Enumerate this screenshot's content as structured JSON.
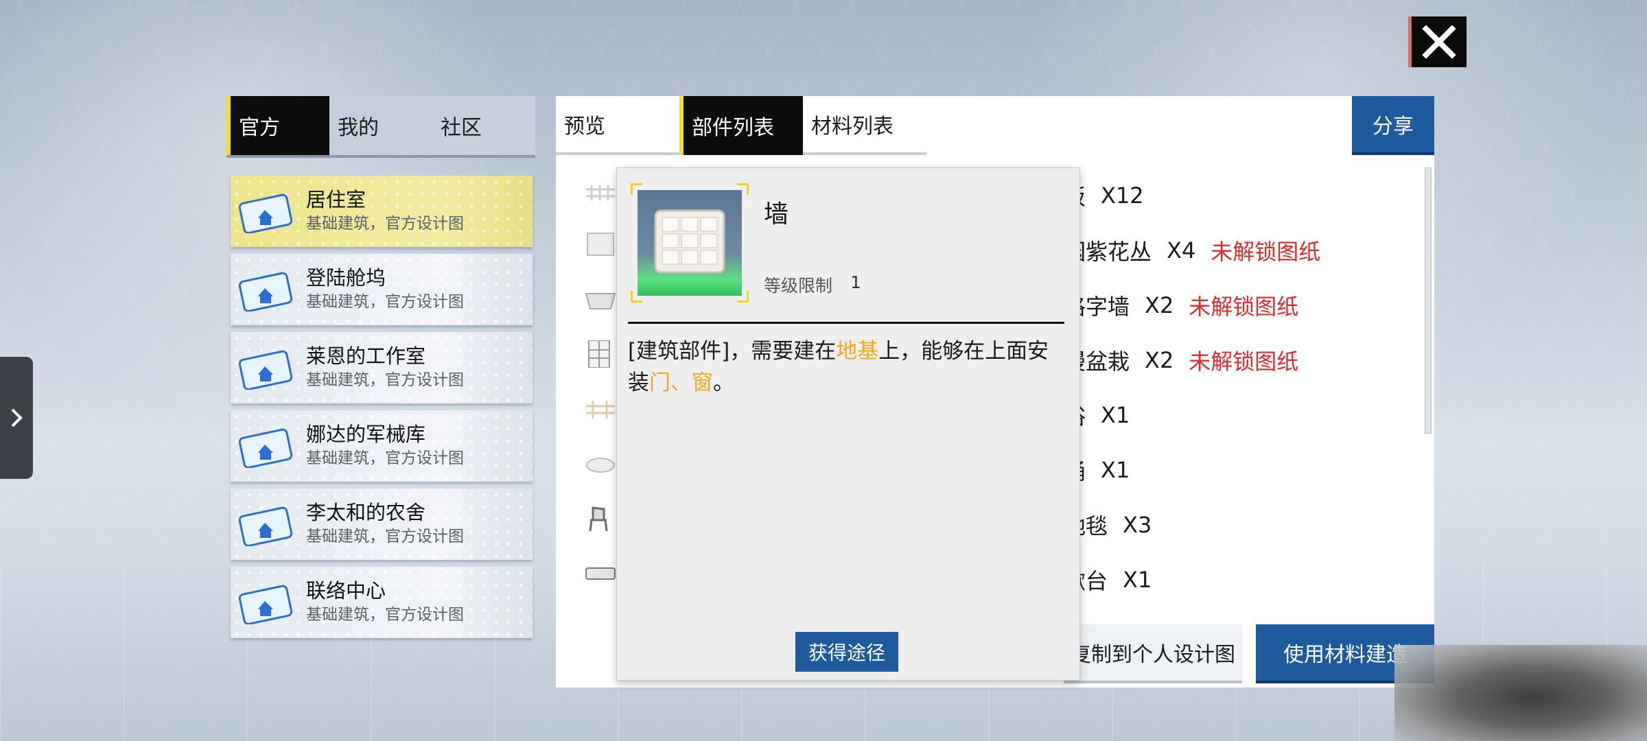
{
  "left_tabs": [
    {
      "label": "官方",
      "active": true
    },
    {
      "label": "我的",
      "active": false
    },
    {
      "label": "社区",
      "active": false
    }
  ],
  "designs": [
    {
      "title": "居住室",
      "subtitle": "基础建筑，官方设计图",
      "active": true
    },
    {
      "title": "登陆舱坞",
      "subtitle": "基础建筑，官方设计图",
      "active": false
    },
    {
      "title": "莱恩的工作室",
      "subtitle": "基础建筑，官方设计图",
      "active": false
    },
    {
      "title": "娜达的军械库",
      "subtitle": "基础建筑，官方设计图",
      "active": false
    },
    {
      "title": "李太和的农舍",
      "subtitle": "基础建筑，官方设计图",
      "active": false
    },
    {
      "title": "联络中心",
      "subtitle": "基础建筑，官方设计图",
      "active": false
    }
  ],
  "main_tabs": [
    {
      "label": "预览",
      "active": false
    },
    {
      "label": "部件列表",
      "active": true
    },
    {
      "label": "材料列表",
      "active": false
    }
  ],
  "share_label": "分享",
  "materials": [
    {
      "name": "板",
      "qty": "X12",
      "note": ""
    },
    {
      "name": "园紫花丛",
      "qty": "X4",
      "note": "未解锁图纸"
    },
    {
      "name": "格字墙",
      "qty": "X2",
      "note": "未解锁图纸"
    },
    {
      "name": "漫盆栽",
      "qty": "X2",
      "note": "未解锁图纸"
    },
    {
      "name": "浴",
      "qty": "X1",
      "note": ""
    },
    {
      "name": "桶",
      "qty": "X1",
      "note": ""
    },
    {
      "name": "地毯",
      "qty": "X3",
      "note": ""
    },
    {
      "name": "漱台",
      "qty": "X1",
      "note": ""
    }
  ],
  "copy_button_label": "复制到个人设计图",
  "build_button_label": "使用材料建造",
  "popup": {
    "title": "墙",
    "level_label": "等级限制",
    "level_value": "1",
    "desc_parts": {
      "p1": "[建筑部件]，需要建在",
      "h1": "地基",
      "p2": "上，能够在上面安装",
      "h2": "门、窗",
      "p3": "。"
    },
    "obtain_label": "获得途径"
  },
  "colors": {
    "accent_yellow": "#f2dc2e",
    "primary_blue": "#1e5a9c",
    "warning_red": "#e02a2a",
    "highlight_orange": "#f4a81a"
  }
}
